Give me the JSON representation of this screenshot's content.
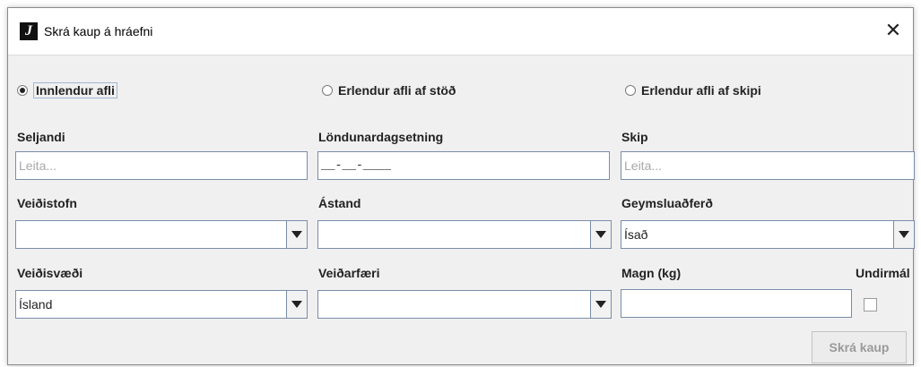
{
  "window": {
    "title": "Skrá kaup á hráefni",
    "icon": "java-logo-icon",
    "close_glyph": "✕"
  },
  "source_options": [
    {
      "label": "Innlendur afli",
      "selected": true
    },
    {
      "label": "Erlendur afli af stöð",
      "selected": false
    },
    {
      "label": "Erlendur afli af skipi",
      "selected": false
    }
  ],
  "form": {
    "seljandi": {
      "label": "Seljandi",
      "placeholder": "Leita...",
      "value": ""
    },
    "londunardagsetning": {
      "label": "Löndunardagsetning",
      "value": "__-__-____"
    },
    "skip": {
      "label": "Skip",
      "placeholder": "Leita...",
      "value": ""
    },
    "veidistofn": {
      "label": "Veiðistofn",
      "value": ""
    },
    "astand": {
      "label": "Ástand",
      "value": ""
    },
    "geymsluadferd": {
      "label": "Geymsluaðferð",
      "value": "Ísað"
    },
    "veidisvaedi": {
      "label": "Veiðisvæði",
      "value": "Ísland"
    },
    "veidarfaeri": {
      "label": "Veiðarfæri",
      "value": ""
    },
    "magn": {
      "label": "Magn (kg)",
      "value": ""
    },
    "undirmal": {
      "label": "Undirmál",
      "checked": false
    }
  },
  "actions": {
    "submit_label": "Skrá kaup",
    "submit_enabled": false
  },
  "colors": {
    "dialog_bg": "#f0f0f0",
    "field_border": "#7a8da8",
    "placeholder": "#a8a8a8",
    "disabled_text": "#9a9a9a"
  }
}
